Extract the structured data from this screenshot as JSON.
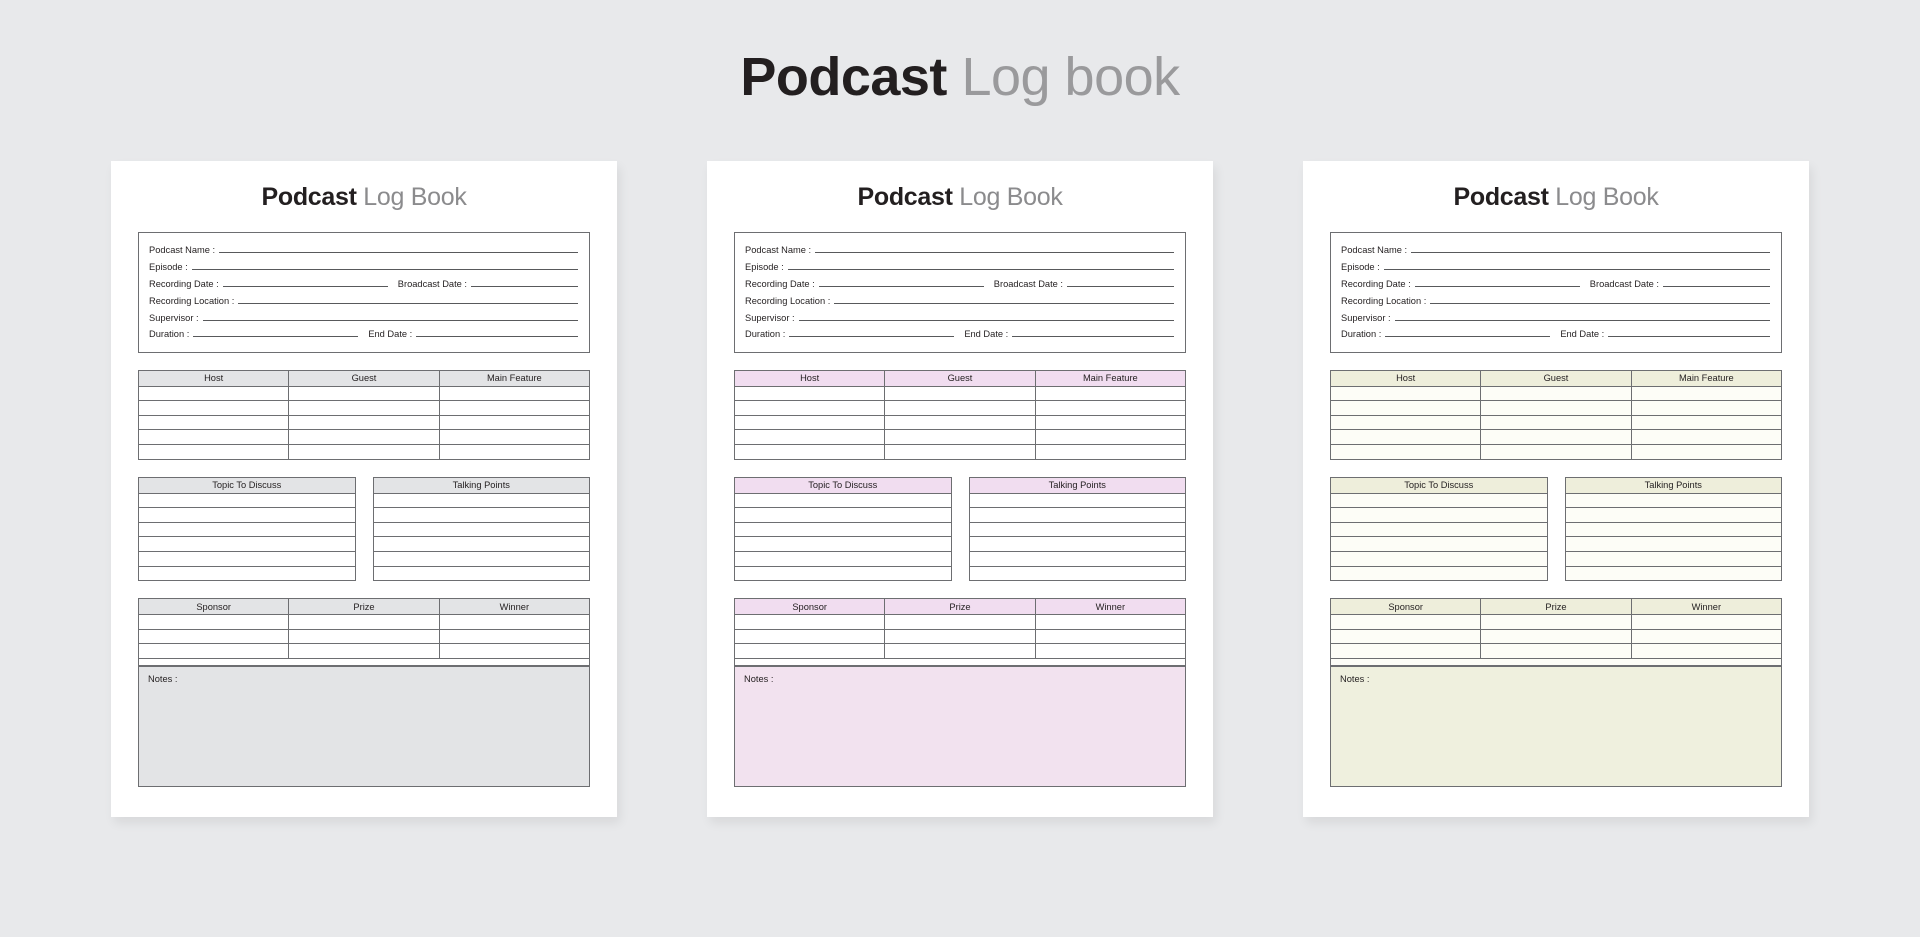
{
  "main_heading": {
    "bold": "Podcast",
    "light": "Log book"
  },
  "card_title": {
    "bold": "Podcast",
    "light": "Log Book"
  },
  "info_fields": {
    "podcast_name": "Podcast Name :",
    "episode": "Episode :",
    "recording_date": "Recording Date :",
    "broadcast_date": "Broadcast Date :",
    "recording_location": "Recording Location :",
    "supervisor": "Supervisor :",
    "duration": "Duration :",
    "end_date": "End Date :"
  },
  "tables": {
    "people": {
      "headers": [
        "Host",
        "Guest",
        "Main Feature"
      ],
      "row_count": 5
    },
    "lists": {
      "topic_header": "Topic To Discuss",
      "talking_header": "Talking Points",
      "row_count": 6
    },
    "sponsor": {
      "headers": [
        "Sponsor",
        "Prize",
        "Winner"
      ],
      "row_count": 3
    }
  },
  "notes_label": "Notes :",
  "cards": [
    {
      "theme": "gray",
      "accent": "#e3e4e6",
      "notes_bg": "#e3e4e6"
    },
    {
      "theme": "pink",
      "accent": "#f1ddf0",
      "notes_bg": "#f2e2ef"
    },
    {
      "theme": "cream",
      "accent": "#eeeedb",
      "notes_bg": "#eff0de"
    }
  ],
  "colors": {
    "background": "#e8e9eb",
    "card_bg": "#ffffff",
    "ink": "#231f20",
    "muted_ink": "#8b8b8d",
    "border": "#6d6e71"
  }
}
